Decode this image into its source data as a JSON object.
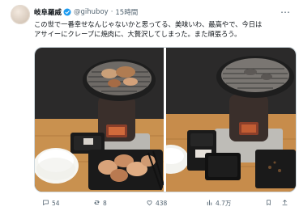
{
  "post": {
    "author_name": "岐阜羅威",
    "handle": "@gihuboy",
    "separator": "·",
    "time": "15時間",
    "text_line1": "この世で一番幸せなんじゃないかと思ってる、美味いわ、最高やで、今日は",
    "text_line2": "アサイーにクレープに焼肉に、大贅沢してしまった。また頑張ろう。",
    "more_label": "…"
  },
  "media": {
    "photo_left_name": "yakiniku-with-meat-and-rice",
    "photo_right_name": "grill-after-eating"
  },
  "actions": {
    "replies": "54",
    "reposts": "8",
    "likes": "438",
    "views": "4.7万"
  },
  "colors": {
    "text": "#0f1419",
    "muted": "#536471",
    "verified": "#1d9bf0",
    "border": "#cfd9de"
  }
}
